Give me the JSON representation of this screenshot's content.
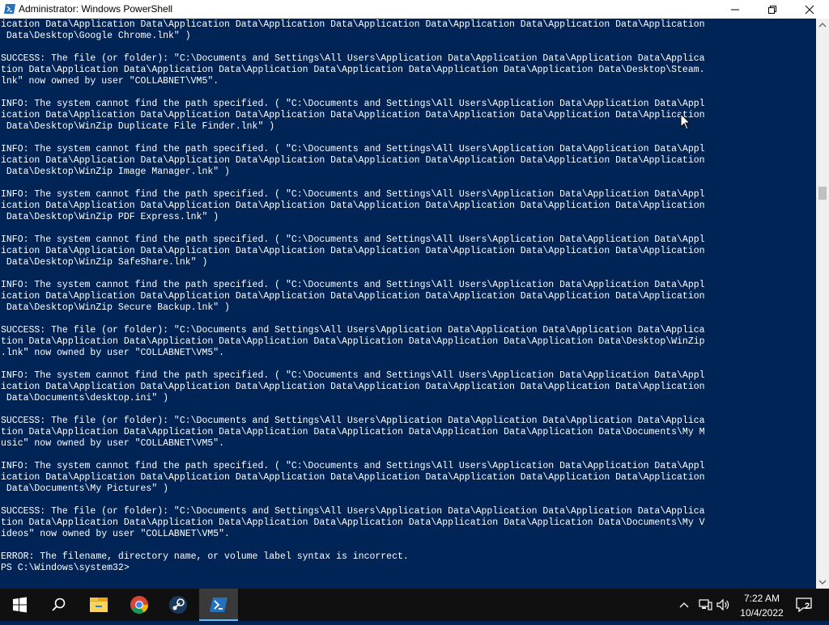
{
  "window": {
    "title": "Administrator: Windows PowerShell"
  },
  "console": {
    "lines": [
      "ication Data\\Application Data\\Application Data\\Application Data\\Application Data\\Application Data\\Application Data\\Application",
      " Data\\Desktop\\Google Chrome.lnk\" )",
      "",
      "SUCCESS: The file (or folder): \"C:\\Documents and Settings\\All Users\\Application Data\\Application Data\\Application Data\\Applica",
      "tion Data\\Application Data\\Application Data\\Application Data\\Application Data\\Application Data\\Application Data\\Desktop\\Steam.",
      "lnk\" now owned by user \"COLLABNET\\VM5\".",
      "",
      "INFO: The system cannot find the path specified. ( \"C:\\Documents and Settings\\All Users\\Application Data\\Application Data\\Appl",
      "ication Data\\Application Data\\Application Data\\Application Data\\Application Data\\Application Data\\Application Data\\Application",
      " Data\\Desktop\\WinZip Duplicate File Finder.lnk\" )",
      "",
      "INFO: The system cannot find the path specified. ( \"C:\\Documents and Settings\\All Users\\Application Data\\Application Data\\Appl",
      "ication Data\\Application Data\\Application Data\\Application Data\\Application Data\\Application Data\\Application Data\\Application",
      " Data\\Desktop\\WinZip Image Manager.lnk\" )",
      "",
      "INFO: The system cannot find the path specified. ( \"C:\\Documents and Settings\\All Users\\Application Data\\Application Data\\Appl",
      "ication Data\\Application Data\\Application Data\\Application Data\\Application Data\\Application Data\\Application Data\\Application",
      " Data\\Desktop\\WinZip PDF Express.lnk\" )",
      "",
      "INFO: The system cannot find the path specified. ( \"C:\\Documents and Settings\\All Users\\Application Data\\Application Data\\Appl",
      "ication Data\\Application Data\\Application Data\\Application Data\\Application Data\\Application Data\\Application Data\\Application",
      " Data\\Desktop\\WinZip SafeShare.lnk\" )",
      "",
      "INFO: The system cannot find the path specified. ( \"C:\\Documents and Settings\\All Users\\Application Data\\Application Data\\Appl",
      "ication Data\\Application Data\\Application Data\\Application Data\\Application Data\\Application Data\\Application Data\\Application",
      " Data\\Desktop\\WinZip Secure Backup.lnk\" )",
      "",
      "SUCCESS: The file (or folder): \"C:\\Documents and Settings\\All Users\\Application Data\\Application Data\\Application Data\\Applica",
      "tion Data\\Application Data\\Application Data\\Application Data\\Application Data\\Application Data\\Application Data\\Desktop\\WinZip",
      ".lnk\" now owned by user \"COLLABNET\\VM5\".",
      "",
      "INFO: The system cannot find the path specified. ( \"C:\\Documents and Settings\\All Users\\Application Data\\Application Data\\Appl",
      "ication Data\\Application Data\\Application Data\\Application Data\\Application Data\\Application Data\\Application Data\\Application",
      " Data\\Documents\\desktop.ini\" )",
      "",
      "SUCCESS: The file (or folder): \"C:\\Documents and Settings\\All Users\\Application Data\\Application Data\\Application Data\\Applica",
      "tion Data\\Application Data\\Application Data\\Application Data\\Application Data\\Application Data\\Application Data\\Documents\\My M",
      "usic\" now owned by user \"COLLABNET\\VM5\".",
      "",
      "INFO: The system cannot find the path specified. ( \"C:\\Documents and Settings\\All Users\\Application Data\\Application Data\\Appl",
      "ication Data\\Application Data\\Application Data\\Application Data\\Application Data\\Application Data\\Application Data\\Application",
      " Data\\Documents\\My Pictures\" )",
      "",
      "SUCCESS: The file (or folder): \"C:\\Documents and Settings\\All Users\\Application Data\\Application Data\\Application Data\\Applica",
      "tion Data\\Application Data\\Application Data\\Application Data\\Application Data\\Application Data\\Application Data\\Documents\\My V",
      "ideos\" now owned by user \"COLLABNET\\VM5\".",
      "",
      "ERROR: The filename, directory name, or volume label syntax is incorrect.",
      "PS C:\\Windows\\system32>"
    ]
  },
  "taskbar": {
    "time": "7:22 AM",
    "date": "10/4/2022",
    "notification_count": "2",
    "icons": [
      "windows-start-icon",
      "search-icon",
      "file-explorer-icon",
      "chrome-icon",
      "steam-icon",
      "powershell-icon"
    ]
  },
  "colors": {
    "console_bg": "#012456",
    "console_text": "#ffffff",
    "taskbar_bg": "#101010",
    "accent": "#0078d7"
  }
}
